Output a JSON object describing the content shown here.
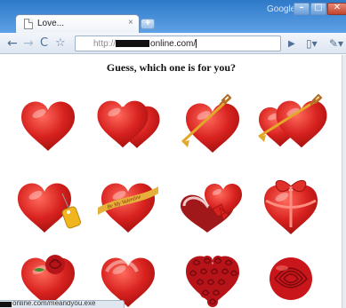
{
  "window": {
    "corner_label": "Google",
    "controls": {
      "minimize": "–",
      "maximize": "□",
      "close": "✕"
    }
  },
  "tab": {
    "title": "Love...",
    "close_glyph": "×",
    "new_tab_glyph": "+"
  },
  "toolbar": {
    "back": "←",
    "forward": "→",
    "reload": "C",
    "star": "☆",
    "url_scheme": "http://",
    "url_domain": "online.com/",
    "go": "▶",
    "page_menu": "▯▾",
    "wrench": "✎▾"
  },
  "page": {
    "heading": "Guess, which one is for you?"
  },
  "hearts": [
    {
      "name": "heart-plain",
      "style": "plain"
    },
    {
      "name": "heart-double",
      "style": "double"
    },
    {
      "name": "heart-arrow",
      "style": "arrow"
    },
    {
      "name": "heart-double-arrow",
      "style": "double-arrow"
    },
    {
      "name": "heart-tag",
      "style": "tag"
    },
    {
      "name": "heart-ribbon-text",
      "style": "ribbon-text",
      "ribbon_text": "Be My Valentine"
    },
    {
      "name": "heart-gift-box",
      "style": "box"
    },
    {
      "name": "heart-bow",
      "style": "bow"
    },
    {
      "name": "heart-rose",
      "style": "rose"
    },
    {
      "name": "heart-shine",
      "style": "shine"
    },
    {
      "name": "heart-of-roses",
      "style": "roses"
    },
    {
      "name": "rose-flower",
      "style": "flower"
    }
  ],
  "status_bar": {
    "url": "online.com/meandyou.exe"
  },
  "colors": {
    "heart_red": "#d8221f",
    "heart_dark": "#9e0f0e",
    "arrow_gold": "#e3a72a",
    "tag_yellow": "#f1b51d"
  }
}
